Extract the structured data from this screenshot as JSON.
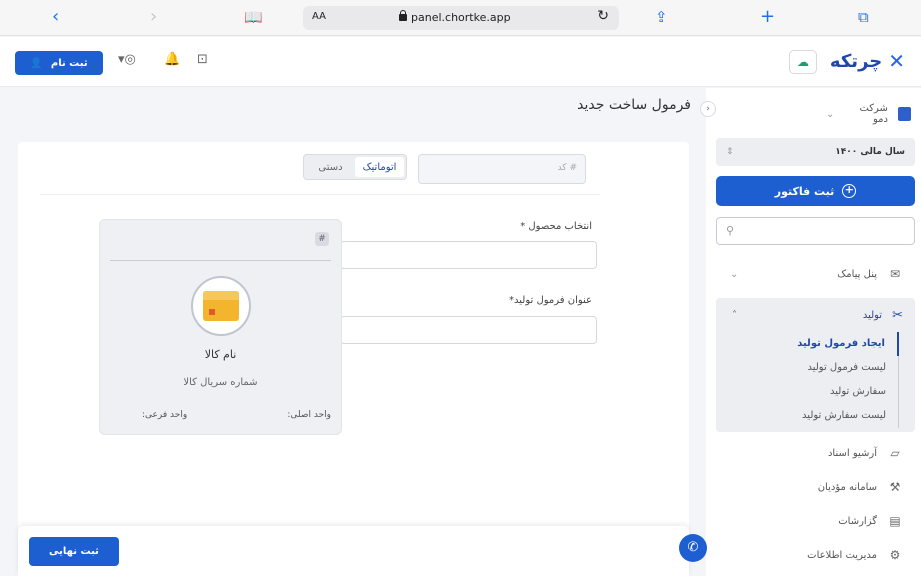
{
  "browser": {
    "aa": "AA",
    "url": "panel.chortke.app"
  },
  "header": {
    "signup_label": "ثبت نام",
    "logo_text": "چرتکه"
  },
  "sidebar": {
    "company": "شرکت دمو",
    "fiscal_year": "سال مالی ۱۴۰۰",
    "invoice_button": "ثبت فاکتور",
    "search_placeholder": "",
    "sms_panel": "پنل پیامک",
    "production": {
      "label": "تولید",
      "items": [
        "ایجاد فرمول تولید",
        "لیست فرمول تولید",
        "سفارش تولید",
        "لیست سفارش تولید"
      ]
    },
    "archive": "آرشیو اسناد",
    "taxpayers": "سامانه مؤدیان",
    "reports": "گزارشات",
    "data_management": "مدیریت اطلاعات"
  },
  "main": {
    "title": "فرمول ساخت جدید",
    "code_placeholder": "کد #",
    "toggle": {
      "auto": "اتوماتیک",
      "manual": "دستی"
    },
    "product_label": "انتخاب محصول *",
    "formula_label": "عنوان فرمول تولید*",
    "product_card": {
      "name": "نام کالا",
      "serial": "شماره سریال کالا",
      "main_unit": "واحد اصلی:",
      "sub_unit": "واحد فرعی:"
    },
    "final_button": "ثبت نهایی"
  }
}
